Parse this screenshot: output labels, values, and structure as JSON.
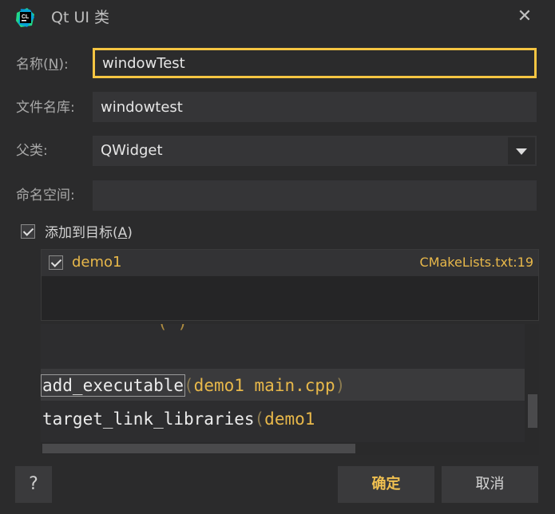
{
  "window": {
    "title": "Qt UI 类",
    "close_glyph": "✕"
  },
  "app_icon": {
    "text": "CL"
  },
  "form": {
    "name": {
      "label_prefix": "名称(",
      "label_mnemonic": "N",
      "label_suffix": "):",
      "value": "windowTest"
    },
    "filename": {
      "label": "文件名库:",
      "value": "windowtest"
    },
    "parent": {
      "label": "父类:",
      "value": "QWidget"
    },
    "namespace": {
      "label": "命名空间:",
      "value": ""
    }
  },
  "add_to_target": {
    "label_prefix": "添加到目标(",
    "label_mnemonic": "A",
    "label_suffix": ")",
    "checked": true,
    "targets": [
      {
        "name": "demo1",
        "file": "CMakeLists.txt:19",
        "checked": true
      }
    ]
  },
  "code_preview": {
    "line1": {
      "fn": "add_executable",
      "open": "(",
      "args": "demo1 main.cpp",
      "close": ")"
    },
    "line2": {
      "fn": "target_link_libraries",
      "open": "(",
      "args": "demo1"
    }
  },
  "buttons": {
    "help": "?",
    "ok": "确定",
    "cancel": "取消"
  },
  "colors": {
    "accent": "#f5c542",
    "code_arg": "#e8b84a",
    "background": "#2b2b2c"
  }
}
